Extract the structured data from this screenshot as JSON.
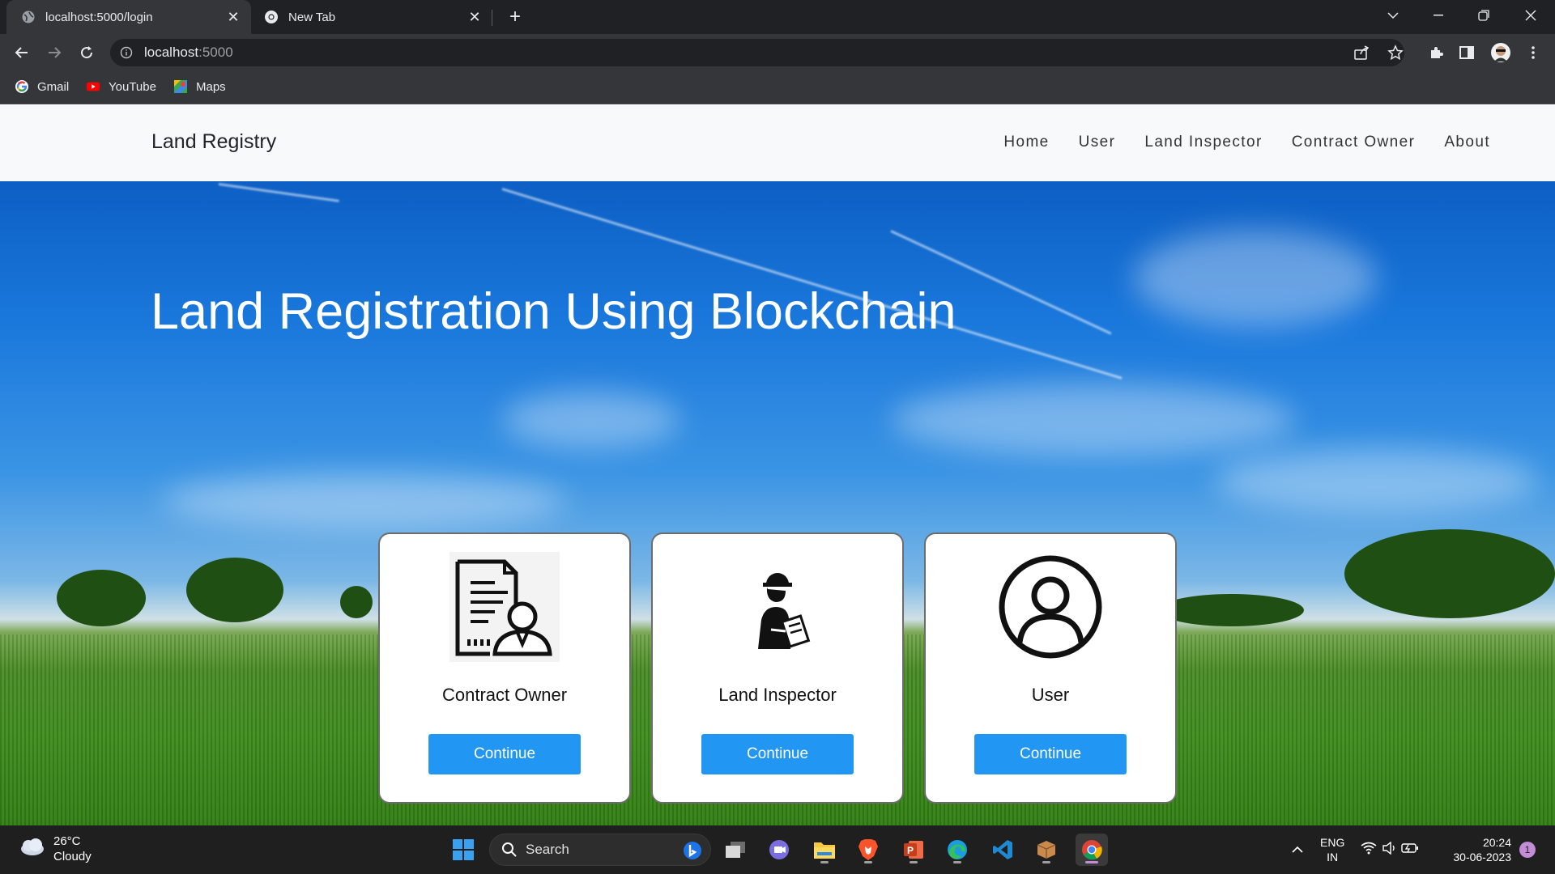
{
  "browser": {
    "tabs": [
      {
        "title": "localhost:5000/login",
        "active": true
      },
      {
        "title": "New Tab",
        "active": false
      }
    ],
    "url_host": "localhost",
    "url_port": ":5000",
    "bookmarks": [
      {
        "label": "Gmail",
        "icon": "google-icon"
      },
      {
        "label": "YouTube",
        "icon": "youtube-icon"
      },
      {
        "label": "Maps",
        "icon": "maps-icon"
      }
    ]
  },
  "site": {
    "brand": "Land Registry",
    "nav": [
      "Home",
      "User",
      "Land Inspector",
      "Contract Owner",
      "About"
    ],
    "hero_title": "Land Registration Using Blockchain",
    "cards": [
      {
        "title": "Contract Owner",
        "button": "Continue",
        "icon": "contract-owner-icon"
      },
      {
        "title": "Land Inspector",
        "button": "Continue",
        "icon": "land-inspector-icon"
      },
      {
        "title": "User",
        "button": "Continue",
        "icon": "user-icon"
      }
    ],
    "accent_color": "#2196f3"
  },
  "taskbar": {
    "weather_temp": "26°C",
    "weather_desc": "Cloudy",
    "search_label": "Search",
    "lang_line1": "ENG",
    "lang_line2": "IN",
    "time": "20:24",
    "date": "30-06-2023",
    "notification_count": "1"
  }
}
